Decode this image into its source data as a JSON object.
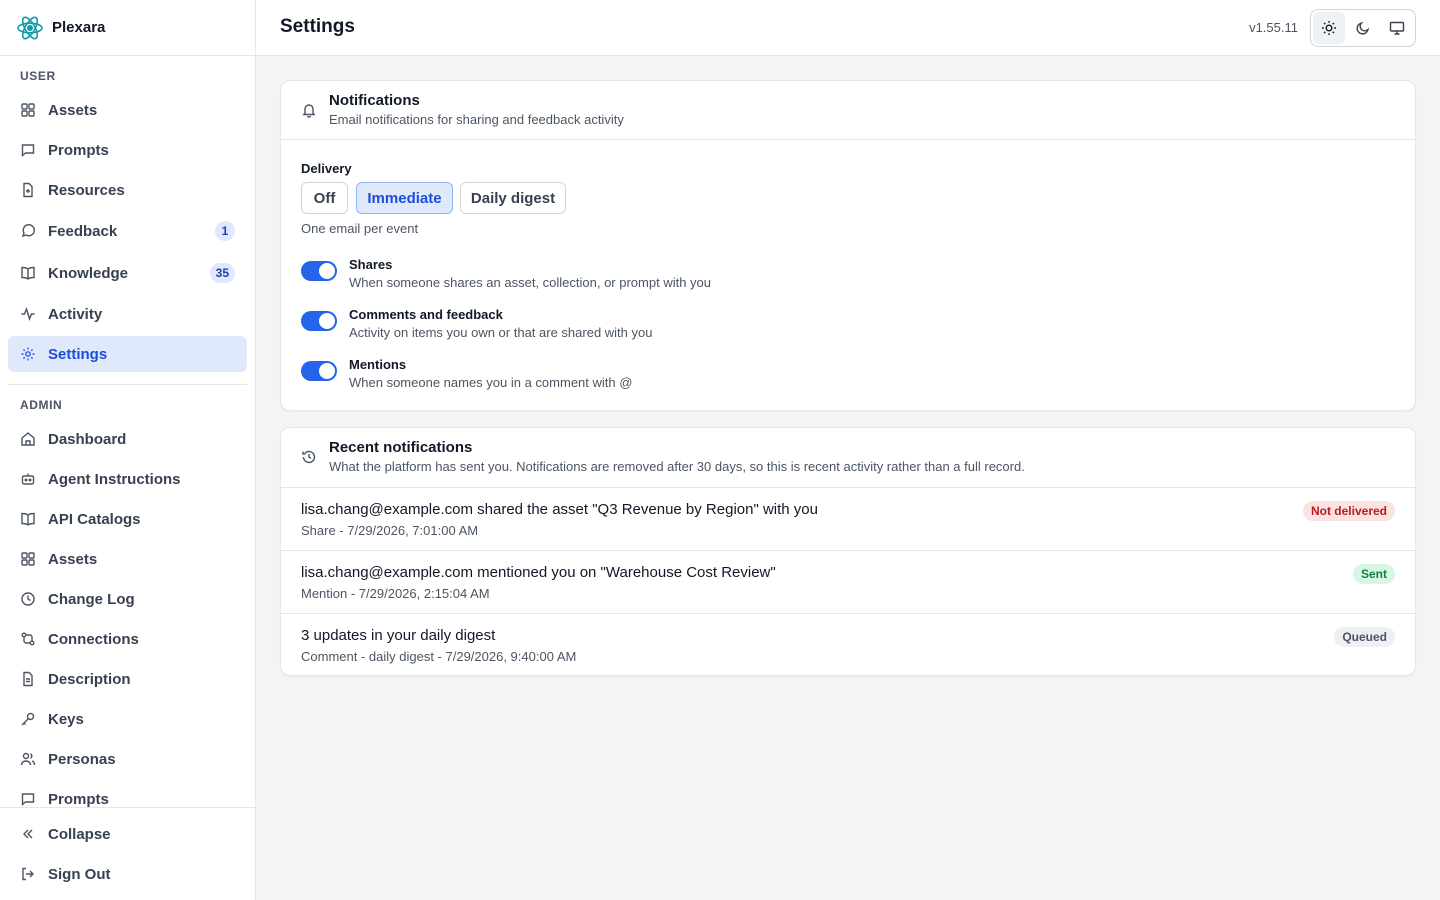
{
  "app": {
    "name": "Plexara",
    "version": "v1.55.11"
  },
  "sidebar": {
    "user_label": "USER",
    "user_items": [
      {
        "label": "Assets",
        "icon": "grid-icon"
      },
      {
        "label": "Prompts",
        "icon": "message-square-icon"
      },
      {
        "label": "Resources",
        "icon": "file-plus-icon"
      },
      {
        "label": "Feedback",
        "icon": "message-circle-icon",
        "badge": "1"
      },
      {
        "label": "Knowledge",
        "icon": "book-open-icon",
        "badge": "35"
      },
      {
        "label": "Activity",
        "icon": "activity-icon"
      },
      {
        "label": "Settings",
        "icon": "gear-icon",
        "active": true
      }
    ],
    "admin_label": "ADMIN",
    "admin_items": [
      {
        "label": "Dashboard",
        "icon": "home-icon"
      },
      {
        "label": "Agent Instructions",
        "icon": "bot-icon"
      },
      {
        "label": "API Catalogs",
        "icon": "book-open-icon"
      },
      {
        "label": "Assets",
        "icon": "grid-icon"
      },
      {
        "label": "Change Log",
        "icon": "clock-icon"
      },
      {
        "label": "Connections",
        "icon": "connection-icon"
      },
      {
        "label": "Description",
        "icon": "file-text-icon"
      },
      {
        "label": "Keys",
        "icon": "key-icon"
      },
      {
        "label": "Personas",
        "icon": "users-icon"
      },
      {
        "label": "Prompts",
        "icon": "message-square-icon"
      }
    ],
    "footer": {
      "collapse": "Collapse",
      "sign_out": "Sign Out"
    }
  },
  "header": {
    "title": "Settings",
    "theme_options": [
      "light-theme",
      "dark-theme",
      "system-theme"
    ],
    "theme_selected": "light-theme"
  },
  "notifications_card": {
    "title": "Notifications",
    "subtitle": "Email notifications for sharing and feedback activity",
    "delivery_label": "Delivery",
    "delivery_options": [
      "Off",
      "Immediate",
      "Daily digest"
    ],
    "delivery_selected": "Immediate",
    "delivery_hint": "One email per event",
    "toggles": [
      {
        "title": "Shares",
        "desc": "When someone shares an asset, collection, or prompt with you",
        "on": true
      },
      {
        "title": "Comments and feedback",
        "desc": "Activity on items you own or that are shared with you",
        "on": true
      },
      {
        "title": "Mentions",
        "desc": "When someone names you in a comment with @",
        "on": true
      }
    ]
  },
  "recent_card": {
    "title": "Recent notifications",
    "subtitle": "What the platform has sent you. Notifications are removed after 30 days, so this is recent activity rather than a full record.",
    "rows": [
      {
        "message": "lisa.chang@example.com shared the asset \"Q3 Revenue by Region\" with you",
        "meta": "Share - 7/29/2026, 7:01:00 AM",
        "status": "Not delivered"
      },
      {
        "message": "lisa.chang@example.com mentioned you on \"Warehouse Cost Review\"",
        "meta": "Mention - 7/29/2026, 2:15:04 AM",
        "status": "Sent"
      },
      {
        "message": "3 updates in your daily digest",
        "meta": "Comment - daily digest - 7/29/2026, 9:40:00 AM",
        "status": "Queued"
      }
    ]
  },
  "colors": {
    "accent": "#2563eb",
    "active_bg": "#e0e9fb",
    "error": "#b91c1c",
    "success": "#15803d"
  }
}
